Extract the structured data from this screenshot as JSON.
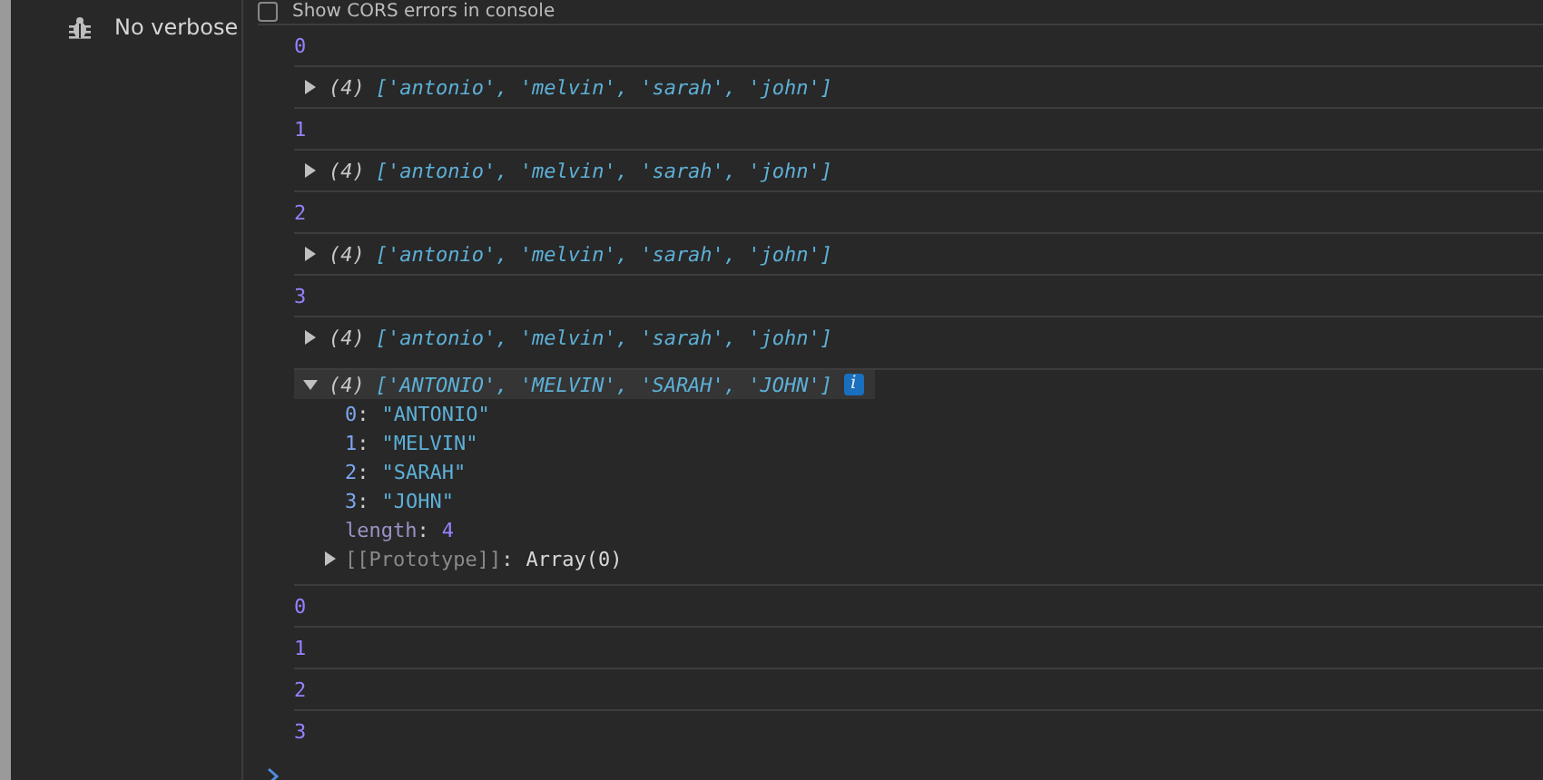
{
  "sidebar": {
    "items": [
      {
        "label": "No verbose",
        "selected": false
      }
    ]
  },
  "console": {
    "setting": {
      "label": "Show CORS errors in console",
      "checked": false
    },
    "entries": [
      {
        "kind": "number",
        "value": "0"
      },
      {
        "kind": "array",
        "count": "(4)",
        "preview": "['antonio', 'melvin', 'sarah', 'john']",
        "expanded": false
      },
      {
        "kind": "number",
        "value": "1"
      },
      {
        "kind": "array",
        "count": "(4)",
        "preview": "['antonio', 'melvin', 'sarah', 'john']",
        "expanded": false
      },
      {
        "kind": "number",
        "value": "2"
      },
      {
        "kind": "array",
        "count": "(4)",
        "preview": "['antonio', 'melvin', 'sarah', 'john']",
        "expanded": false
      },
      {
        "kind": "number",
        "value": "3"
      },
      {
        "kind": "array",
        "count": "(4)",
        "preview": "['antonio', 'melvin', 'sarah', 'john']",
        "expanded": false
      },
      {
        "kind": "array",
        "count": "(4)",
        "preview": "['ANTONIO', 'MELVIN', 'SARAH', 'JOHN']",
        "expanded": true,
        "badge": "i",
        "properties": [
          {
            "kind": "string",
            "key": "0",
            "colon": ":",
            "value": "\"ANTONIO\""
          },
          {
            "kind": "string",
            "key": "1",
            "colon": ":",
            "value": "\"MELVIN\""
          },
          {
            "kind": "string",
            "key": "2",
            "colon": ":",
            "value": "\"SARAH\""
          },
          {
            "kind": "string",
            "key": "3",
            "colon": ":",
            "value": "\"JOHN\""
          },
          {
            "kind": "number",
            "key": "length",
            "colon": ":",
            "value": "4"
          },
          {
            "kind": "object",
            "key": "[[Prototype]]",
            "colon": ":",
            "value": "Array(0)",
            "expanded": false
          }
        ]
      },
      {
        "kind": "number",
        "value": "0"
      },
      {
        "kind": "number",
        "value": "1"
      },
      {
        "kind": "number",
        "value": "2"
      },
      {
        "kind": "number",
        "value": "3"
      }
    ]
  }
}
